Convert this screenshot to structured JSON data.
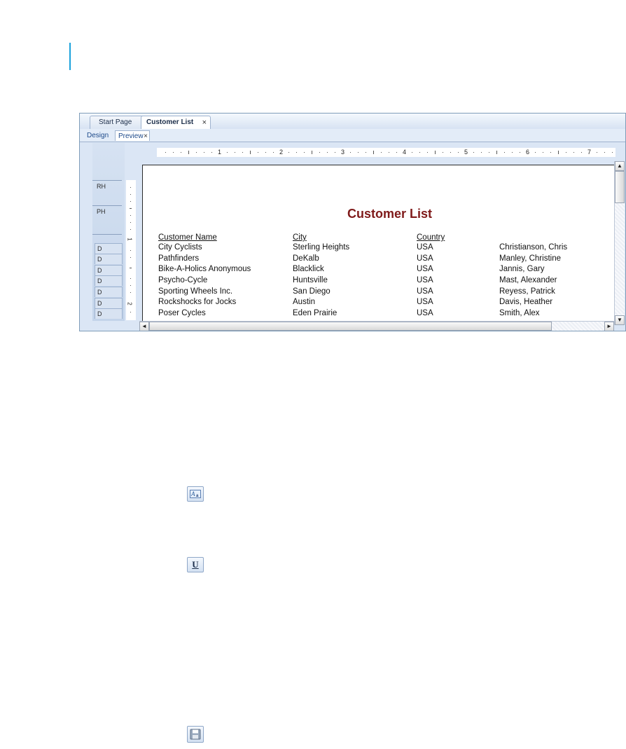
{
  "tabs": {
    "start_page": "Start Page",
    "customer_list": "Customer List",
    "close_glyph": "×"
  },
  "view_tabs": {
    "design": "Design",
    "preview": "Preview",
    "close_glyph": "×"
  },
  "sections": {
    "rh": "RH",
    "ph": "PH",
    "detail": [
      "D",
      "D",
      "D",
      "D",
      "D",
      "D",
      "D"
    ]
  },
  "ruler": {
    "horizontal_numbers": [
      "1",
      "2",
      "3",
      "4",
      "5",
      "6",
      "7"
    ],
    "vertical_numbers": [
      "1",
      "2"
    ]
  },
  "report": {
    "title": "Customer List",
    "title_color": "#7f1a1a",
    "columns": [
      "Customer Name",
      "City",
      "Country"
    ],
    "rows": [
      [
        "City Cyclists",
        "Sterling Heights",
        "USA",
        "Christianson, Chris"
      ],
      [
        "Pathfinders",
        "DeKalb",
        "USA",
        "Manley, Christine"
      ],
      [
        "Bike-A-Holics Anonymous",
        "Blacklick",
        "USA",
        "Jannis, Gary"
      ],
      [
        "Psycho-Cycle",
        "Huntsville",
        "USA",
        "Mast, Alexander"
      ],
      [
        "Sporting Wheels Inc.",
        "San Diego",
        "USA",
        "Reyess, Patrick"
      ],
      [
        "Rockshocks for Jocks",
        "Austin",
        "USA",
        "Davis, Heather"
      ],
      [
        "Poser Cycles",
        "Eden Prairie",
        "USA",
        "Smith, Alex"
      ]
    ]
  },
  "scroll": {
    "up": "▲",
    "down": "▼",
    "left": "◄",
    "right": "►"
  },
  "icons": {
    "text_object": "text-object-icon",
    "underline": "underline-icon",
    "save": "save-icon",
    "underline_glyph": "U"
  },
  "colors": {
    "accent_bar": "#1aa2dc",
    "window_border": "#7f9db9"
  }
}
